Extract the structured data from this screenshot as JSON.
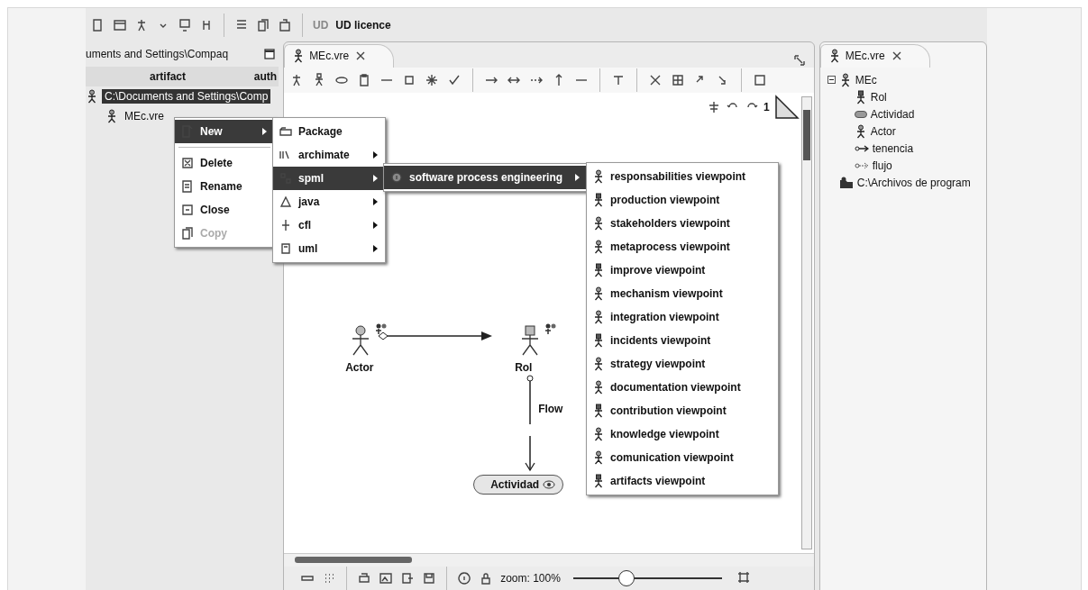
{
  "toolbar": {
    "badge": "UD",
    "label": "UD licence"
  },
  "artifacts_panel": {
    "title": "uments and Settings\\Compaq",
    "columns": [
      "artifact",
      "auth"
    ],
    "tree": [
      {
        "label": "C:\\Documents and Settings\\Comp",
        "selected": true,
        "children": [
          {
            "label": "MEc.vre",
            "selected": false
          }
        ]
      }
    ]
  },
  "editor": {
    "tabs": [
      {
        "label": "MEc.vre",
        "selected": true
      }
    ],
    "page_number": "1",
    "diagram": {
      "nodes": [
        {
          "kind": "actor",
          "label": "Actor"
        },
        {
          "kind": "role",
          "label": "Rol"
        },
        {
          "kind": "activity",
          "label": "Actividad"
        }
      ],
      "edges": [
        {
          "kind": "ownership"
        },
        {
          "kind": "flow",
          "label": "Flow"
        }
      ]
    },
    "zoom_label": "zoom: 100%",
    "zoom_slider": {
      "level": 0.35
    }
  },
  "outline_panel": {
    "tabs": [
      {
        "label": "MEc.vre",
        "selected": true
      }
    ],
    "tree": [
      {
        "label": "MEc",
        "kind": "model",
        "expanded": true,
        "children": [
          {
            "label": "Rol",
            "kind": "role"
          },
          {
            "label": "Actividad",
            "kind": "activity"
          },
          {
            "label": "Actor",
            "kind": "actor"
          },
          {
            "label": "tenencia",
            "kind": "ownership"
          },
          {
            "label": "flujo",
            "kind": "flow"
          }
        ]
      },
      {
        "label": "C:\\Archivos de program",
        "kind": "folder"
      }
    ]
  },
  "context_menu": [
    {
      "kind": "item",
      "label": "New",
      "selected": true,
      "disabled": false,
      "submenu": true
    },
    {
      "kind": "separator"
    },
    {
      "kind": "item",
      "label": "Delete",
      "selected": false,
      "disabled": false,
      "submenu": false
    },
    {
      "kind": "item",
      "label": "Rename",
      "selected": false,
      "disabled": false,
      "submenu": false
    },
    {
      "kind": "item",
      "label": "Close",
      "selected": false,
      "disabled": false,
      "submenu": false
    },
    {
      "kind": "item",
      "label": "Copy",
      "selected": false,
      "disabled": true,
      "submenu": false
    }
  ],
  "new_submenu": [
    {
      "label": "Package",
      "selected": false,
      "submenu": false
    },
    {
      "label": "archimate",
      "selected": false,
      "submenu": true
    },
    {
      "label": "spml",
      "selected": true,
      "submenu": true
    },
    {
      "label": "java",
      "selected": false,
      "submenu": true
    },
    {
      "label": "cfl",
      "selected": false,
      "submenu": true
    },
    {
      "label": "uml",
      "selected": false,
      "submenu": true
    }
  ],
  "spml_submenu": [
    {
      "label": "software process engineering",
      "selected": true,
      "submenu": true
    }
  ],
  "viewpoints_submenu": [
    {
      "label": "responsabilities viewpoint",
      "selected": false
    },
    {
      "label": "production viewpoint",
      "selected": false
    },
    {
      "label": "stakeholders viewpoint",
      "selected": false
    },
    {
      "label": "metaprocess viewpoint",
      "selected": false
    },
    {
      "label": "improve viewpoint",
      "selected": false
    },
    {
      "label": "mechanism viewpoint",
      "selected": false
    },
    {
      "label": "integration viewpoint",
      "selected": false
    },
    {
      "label": "incidents viewpoint",
      "selected": false
    },
    {
      "label": "strategy viewpoint",
      "selected": false
    },
    {
      "label": "documentation viewpoint",
      "selected": false
    },
    {
      "label": "contribution viewpoint",
      "selected": false
    },
    {
      "label": "knowledge viewpoint",
      "selected": false
    },
    {
      "label": "comunication viewpoint",
      "selected": false
    },
    {
      "label": "artifacts viewpoint",
      "selected": false
    }
  ]
}
